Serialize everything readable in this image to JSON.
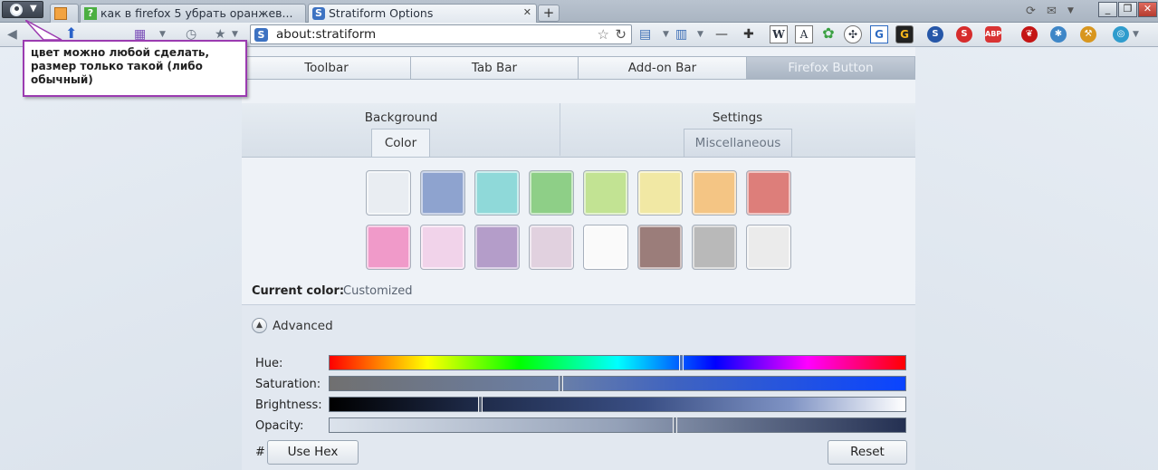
{
  "browser": {
    "tabs": [
      {
        "label": ""
      },
      {
        "label": "как в firefox 5 убрать оранжев..."
      },
      {
        "label": "Stratiform Options"
      }
    ],
    "new_tab": "+",
    "url": "about:stratiform",
    "window_buttons": [
      "_",
      "❐",
      "✕"
    ]
  },
  "note": {
    "text": "цвет можно любой сделать, размер только такой (либо обычный)"
  },
  "addons": [
    "W",
    "A",
    "G"
  ],
  "page": {
    "tabs": [
      {
        "label": "Toolbar"
      },
      {
        "label": "Tab Bar"
      },
      {
        "label": "Add-on Bar"
      },
      {
        "label": "Firefox Button",
        "selected": true
      }
    ],
    "groups": [
      {
        "title": "Background",
        "subtab": "Color"
      },
      {
        "title": "Settings",
        "subtab": "Miscellaneous"
      }
    ],
    "swatches": [
      "#e9edf2",
      "#8ea3cf",
      "#8fd9d9",
      "#8ecf87",
      "#c2e393",
      "#f1e8a4",
      "#f4c584",
      "#dd7e7a",
      "#f09ac9",
      "#f1d3ea",
      "#b49dc9",
      "#e1d1df",
      "#fafafa",
      "#9b7d7a",
      "#b9b9b9",
      "#ebebeb"
    ],
    "current_color_label": "Current color:",
    "current_color_value": "Customized",
    "advanced_label": "Advanced",
    "sliders": [
      {
        "label": "Hue:",
        "value": 0.61
      },
      {
        "label": "Saturation:",
        "value": 0.4
      },
      {
        "label": "Brightness:",
        "value": 0.26
      },
      {
        "label": "Opacity:",
        "value": 0.6
      }
    ],
    "hash": "#",
    "use_hex": "Use Hex",
    "reset": "Reset"
  }
}
